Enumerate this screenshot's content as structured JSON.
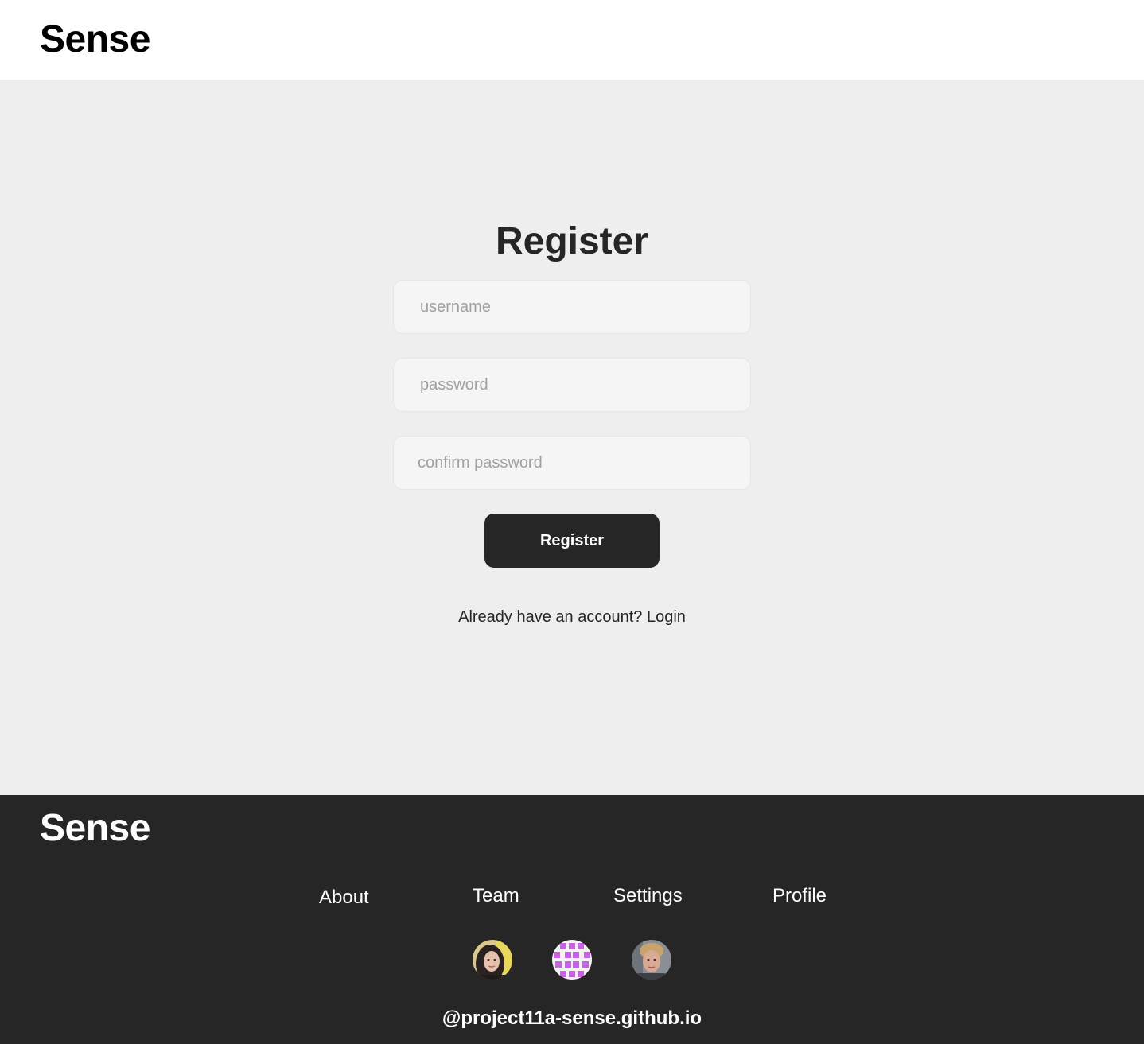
{
  "header": {
    "brand": "Sense"
  },
  "register": {
    "title": "Register",
    "username_placeholder": "username",
    "password_placeholder": "password",
    "confirm_placeholder": "confirm password",
    "submit_label": "Register",
    "account_prompt": "Already have an account?",
    "login_link": "Login"
  },
  "footer": {
    "brand": "Sense",
    "links": [
      {
        "label": "About"
      },
      {
        "label": "Team"
      },
      {
        "label": "Settings"
      },
      {
        "label": "Profile"
      }
    ],
    "avatars": [
      {
        "icon": "avatar-photo-woman"
      },
      {
        "icon": "avatar-pattern-purple"
      },
      {
        "icon": "avatar-photo-man"
      }
    ],
    "site": "@project11a-sense.github.io"
  },
  "colors": {
    "background": "#eeeeee",
    "header_bg": "#ffffff",
    "footer_bg": "#262626",
    "button_bg": "#262626",
    "input_bg": "#f5f5f5",
    "placeholder": "#a0a0a0"
  }
}
